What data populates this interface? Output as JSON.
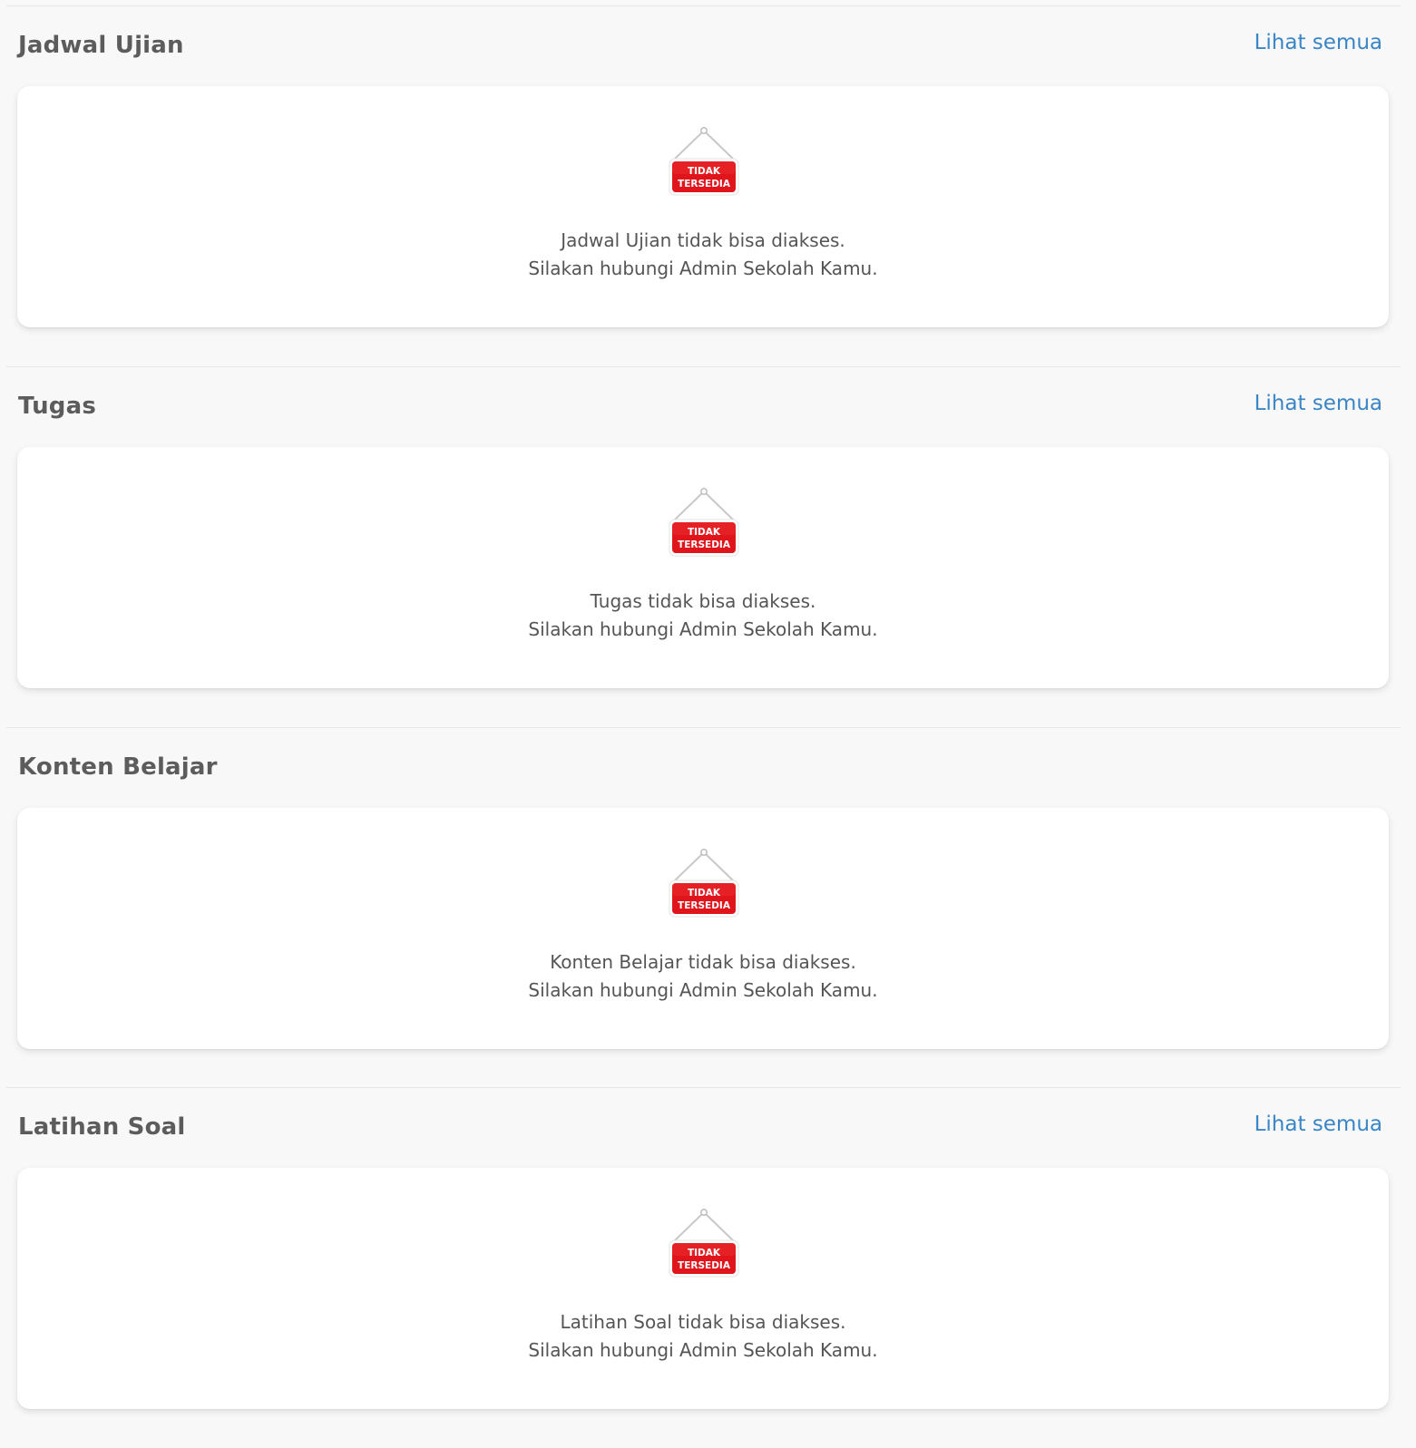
{
  "colors": {
    "background": "#f8f8f8",
    "card": "#ffffff",
    "title": "#5c5c5c",
    "link": "#3a85c6",
    "text": "#555555",
    "sign_red": "#e0151b"
  },
  "sign": {
    "icon": "tidak-tersedia-sign-icon",
    "line1": "TIDAK",
    "line2": "TERSEDIA"
  },
  "sections": [
    {
      "title": "Jadwal Ujian",
      "link": "Lihat semua",
      "message_line1": "Jadwal Ujian tidak bisa diakses.",
      "message_line2": "Silakan hubungi Admin Sekolah Kamu."
    },
    {
      "title": "Tugas",
      "link": "Lihat semua",
      "message_line1": "Tugas tidak bisa diakses.",
      "message_line2": "Silakan hubungi Admin Sekolah Kamu."
    },
    {
      "title": "Konten Belajar",
      "link": "",
      "message_line1": "Konten Belajar tidak bisa diakses.",
      "message_line2": "Silakan hubungi Admin Sekolah Kamu."
    },
    {
      "title": "Latihan Soal",
      "link": "Lihat semua",
      "message_line1": "Latihan Soal tidak bisa diakses.",
      "message_line2": "Silakan hubungi Admin Sekolah Kamu."
    }
  ]
}
